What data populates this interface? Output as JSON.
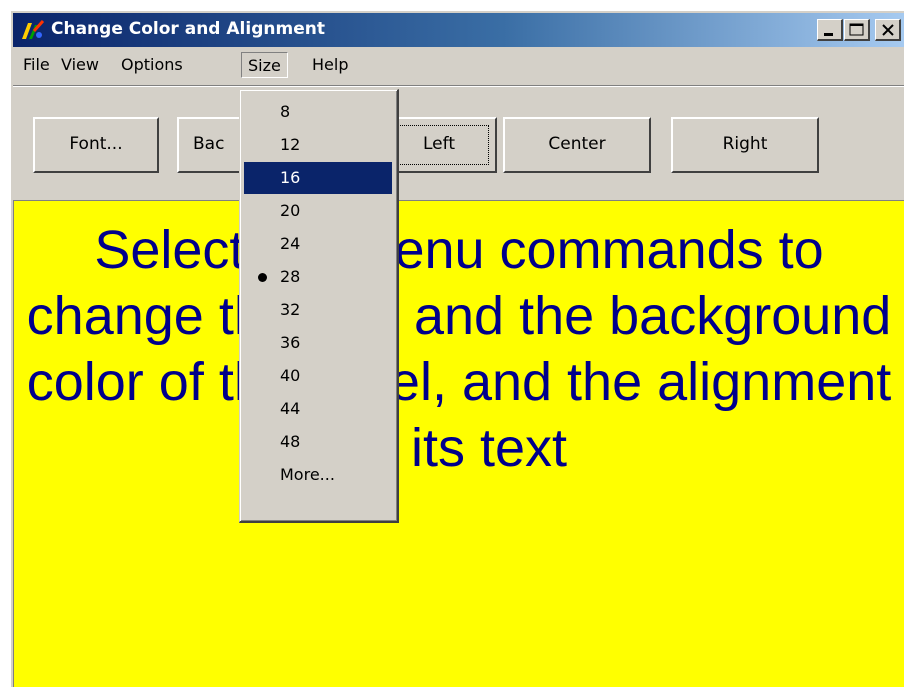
{
  "window": {
    "title": "Change Color and Alignment"
  },
  "menubar": {
    "items": [
      "File",
      "View",
      "Options",
      "Size",
      "Help"
    ],
    "open_menu": "Size"
  },
  "toolbar": {
    "font_label": "Font...",
    "background_label": "Bac",
    "left_label": "Left",
    "center_label": "Center",
    "right_label": "Right",
    "focused_button": "Left"
  },
  "label": {
    "text": "Select the menu commands to change the font and the background color of this label, and the alignment of its text",
    "background_color": "#ffff00",
    "text_color": "#00008b",
    "font_size": "28"
  },
  "size_menu": {
    "items": [
      "8",
      "12",
      "16",
      "20",
      "24",
      "28",
      "32",
      "36",
      "40",
      "44",
      "48",
      "More..."
    ],
    "highlighted": "16",
    "checked": "28"
  },
  "colors": {
    "menu_highlight": "#0a246a",
    "title_gradient_start": "#0a246a",
    "title_gradient_end": "#a6caf0",
    "face": "#d4d0c8"
  }
}
